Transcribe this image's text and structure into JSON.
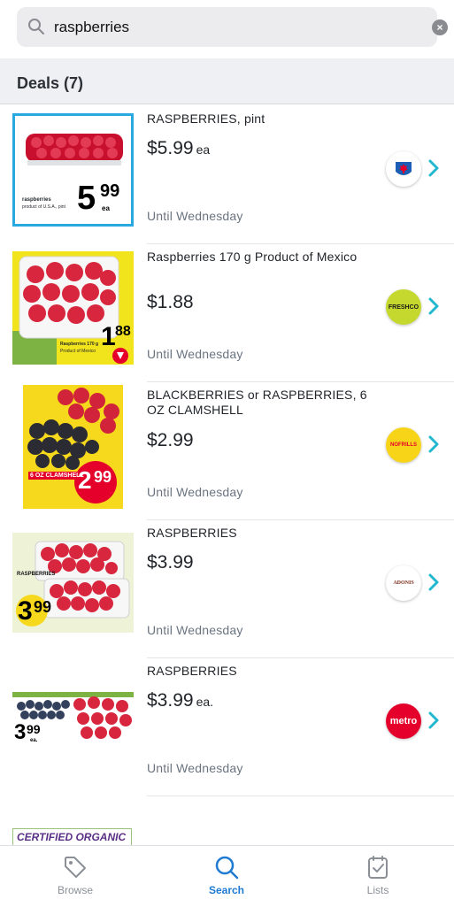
{
  "search": {
    "value": "raspberries",
    "placeholder": "Search"
  },
  "section": {
    "title": "Deals (7)"
  },
  "deals": [
    {
      "title": "RASPBERRIES, pint",
      "price": "$5.99",
      "unit": "ea",
      "until": "Until Wednesday",
      "store_icon": "maple-leaf-store-logo",
      "thumb": {
        "price_big": "5",
        "price_small": "99",
        "unit": "ea",
        "name": "raspberries",
        "sub": "product of U.S.A., pint"
      }
    },
    {
      "title": "Raspberries 170 g Product of Mexico",
      "price": "$1.88",
      "unit": "",
      "until": "Until Wednesday",
      "store_icon": "freshco-logo",
      "store_text": "FRESHCO",
      "thumb": {
        "price_big": "1",
        "price_small": "88",
        "name": "Raspberries 170 g",
        "sub": "Product of Mexico"
      }
    },
    {
      "title": "BLACKBERRIES or RASPBERRIES, 6 OZ CLAMSHELL",
      "price": "$2.99",
      "unit": "",
      "until": "Until Wednesday",
      "store_icon": "nofrills-logo",
      "store_text": "NOFRILLS",
      "thumb": {
        "price_big": "2",
        "price_small": "99",
        "tag": "6 OZ CLAMSHELL"
      }
    },
    {
      "title": "RASPBERRIES",
      "price": "$3.99",
      "unit": "",
      "until": "Until Wednesday",
      "store_icon": "adonis-logo",
      "store_text": "ADONIS",
      "thumb": {
        "price_big": "3",
        "price_small": "99",
        "name": "RASPBERRIES"
      }
    },
    {
      "title": "RASPBERRIES",
      "price": "$3.99",
      "unit": "ea.",
      "until": "Until Wednesday",
      "store_icon": "metro-logo",
      "store_text": "metro",
      "thumb": {
        "price_big": "3",
        "price_small": "99",
        "unit": "ea."
      }
    }
  ],
  "partial": {
    "text": "CERTIFIED ORGANIC"
  },
  "nav": {
    "browse": "Browse",
    "search": "Search",
    "lists": "Lists"
  },
  "colors": {
    "accent": "#1f7bd1",
    "chevron": "#22b8cf",
    "until": "#6a7480"
  }
}
